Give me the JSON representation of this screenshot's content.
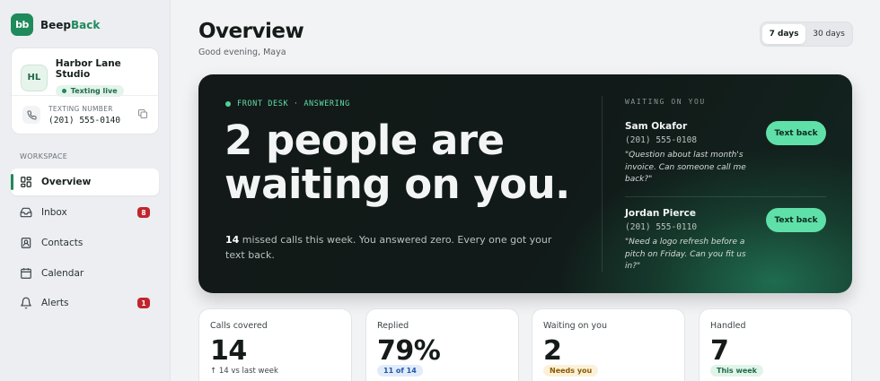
{
  "brand": {
    "logo": "bb",
    "name_part1": "Beep",
    "name_part2": "Back"
  },
  "studio": {
    "initials": "HL",
    "name": "Harbor Lane Studio",
    "status": "Texting live",
    "number_label": "TEXTING NUMBER",
    "number": "(201) 555-0140"
  },
  "sidebar": {
    "section_label": "WORKSPACE",
    "items": [
      {
        "label": "Overview",
        "icon": "grid-icon",
        "active": true
      },
      {
        "label": "Inbox",
        "icon": "inbox-icon",
        "badge": "8"
      },
      {
        "label": "Contacts",
        "icon": "contact-icon"
      },
      {
        "label": "Calendar",
        "icon": "calendar-icon"
      },
      {
        "label": "Alerts",
        "icon": "bell-icon",
        "badge": "1"
      }
    ]
  },
  "header": {
    "title": "Overview",
    "greeting": "Good evening, Maya",
    "ranges": [
      "7 days",
      "30 days"
    ],
    "selected_range": "7 days"
  },
  "hero": {
    "kicker": "FRONT DESK · ANSWERING",
    "headline": "2 people are waiting on you.",
    "missed_count": "14",
    "sub_text": " missed calls this week. You answered zero. Every one got your text back.",
    "waiting_label": "WAITING ON YOU",
    "callers": [
      {
        "name": "Sam Okafor",
        "phone": "(201) 555-0108",
        "message": "\"Question about last month's invoice. Can someone call me back?\"",
        "action": "Text back"
      },
      {
        "name": "Jordan Pierce",
        "phone": "(201) 555-0110",
        "message": "\"Need a logo refresh before a pitch on Friday. Can you fit us in?\"",
        "action": "Text back"
      }
    ]
  },
  "stats": [
    {
      "label": "Calls covered",
      "value": "14",
      "note": "↑ 14 vs last week"
    },
    {
      "label": "Replied",
      "value": "79%",
      "pill": "11 of 14"
    },
    {
      "label": "Waiting on you",
      "value": "2",
      "pill": "Needs you"
    },
    {
      "label": "Handled",
      "value": "7",
      "pill": "This week"
    }
  ],
  "colors": {
    "accent": "#1f8a5b",
    "mint": "#5fe0a8",
    "badge_red": "#c0262d",
    "hero_bg": "#121918"
  }
}
